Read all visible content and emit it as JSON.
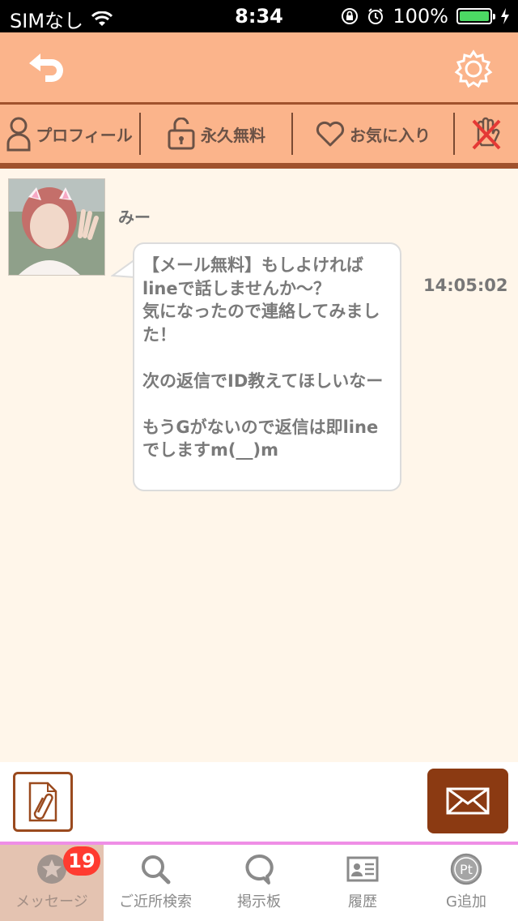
{
  "status_bar": {
    "carrier": "SIMなし",
    "time": "8:34",
    "battery": "100%"
  },
  "tabs": {
    "profile": "プロフィール",
    "free_forever": "永久無料",
    "favorite": "お気に入り"
  },
  "message": {
    "sender": "みー",
    "timestamp": "14:05:02",
    "body": "【メール無料】もしよければlineで話しませんか～？\n気になったので連絡してみました！\n\n次の返信でID教えてほしいなー\n\nもうGがないので返信は即lineでしますm(__)m"
  },
  "tab_bar": {
    "items": [
      {
        "label": "メッセージ",
        "badge": "19"
      },
      {
        "label": "ご近所検索"
      },
      {
        "label": "掲示板"
      },
      {
        "label": "履歴"
      },
      {
        "label": "G追加"
      }
    ]
  },
  "colors": {
    "header": "#fbb48b",
    "accent_brown": "#a0522d",
    "send_button": "#8b3a12",
    "background": "#fff6ea",
    "badge": "#ff3b30"
  }
}
